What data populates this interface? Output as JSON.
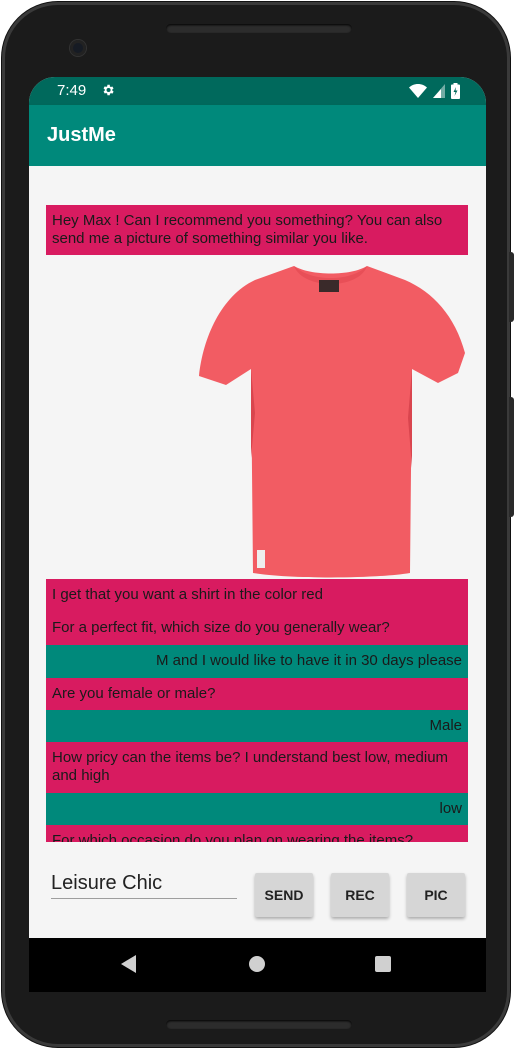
{
  "status_bar": {
    "time": "7:49",
    "gear_icon": "settings-gear",
    "wifi_icon": "wifi-full",
    "signal_icon": "cell-signal-partial",
    "battery_icon": "battery-charging"
  },
  "app_bar": {
    "title": "JustMe"
  },
  "chat": {
    "messages": [
      {
        "from": "bot",
        "text": "Hey Max ! Can I recommend you something? You can also send me a picture of something similar you like."
      },
      {
        "from": "bot",
        "text": "I get that you want a shirt in the color red"
      },
      {
        "from": "bot",
        "text": "For a perfect fit, which size do you generally wear?"
      },
      {
        "from": "user",
        "text": "M and I would like to have it in 30 days please"
      },
      {
        "from": "bot",
        "text": "Are you female or male?"
      },
      {
        "from": "user",
        "text": "Male"
      },
      {
        "from": "bot",
        "text": "How pricy can the items be? I understand best low, medium and high"
      },
      {
        "from": "user",
        "text": "low"
      },
      {
        "from": "bot",
        "text": "For which occasion do you plan on wearing the items?"
      }
    ],
    "image": "red-tshirt-photo"
  },
  "composer": {
    "input_value": "Leisure Chic",
    "send_label": "SEND",
    "rec_label": "REC",
    "pic_label": "PIC"
  },
  "colors": {
    "status_bar": "#00695c",
    "app_bar": "#00897b",
    "bot_bubble": "#d81b60",
    "user_bubble": "#00897b",
    "background": "#f5f5f5"
  }
}
